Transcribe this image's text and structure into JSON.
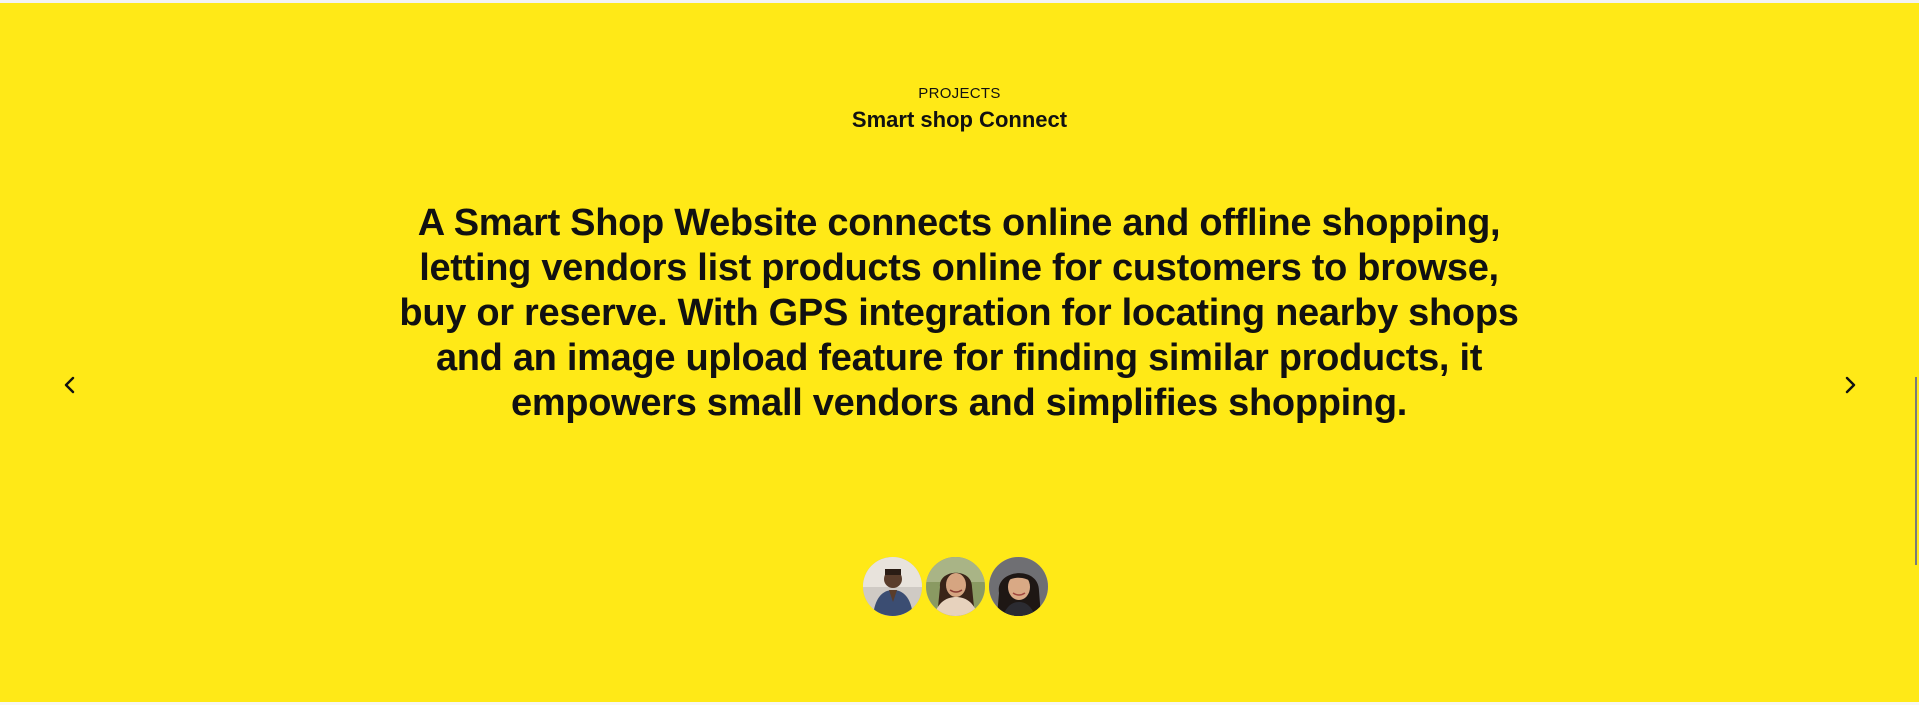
{
  "section": {
    "eyebrow": "PROJECTS",
    "title": "Smart shop Connect",
    "description": "A Smart Shop Website connects online and offline shopping, letting vendors list products online for customers to browse, buy or reserve. With GPS integration for locating nearby shops and an image upload feature for finding similar products, it empowers small vendors and simplifies shopping.",
    "background_color": "#ffe917"
  },
  "navigation": {
    "prev_icon": "chevron-left-icon",
    "next_icon": "chevron-right-icon"
  },
  "team": {
    "avatars": [
      {
        "icon": "avatar-photo"
      },
      {
        "icon": "avatar-photo"
      },
      {
        "icon": "avatar-photo"
      }
    ]
  }
}
